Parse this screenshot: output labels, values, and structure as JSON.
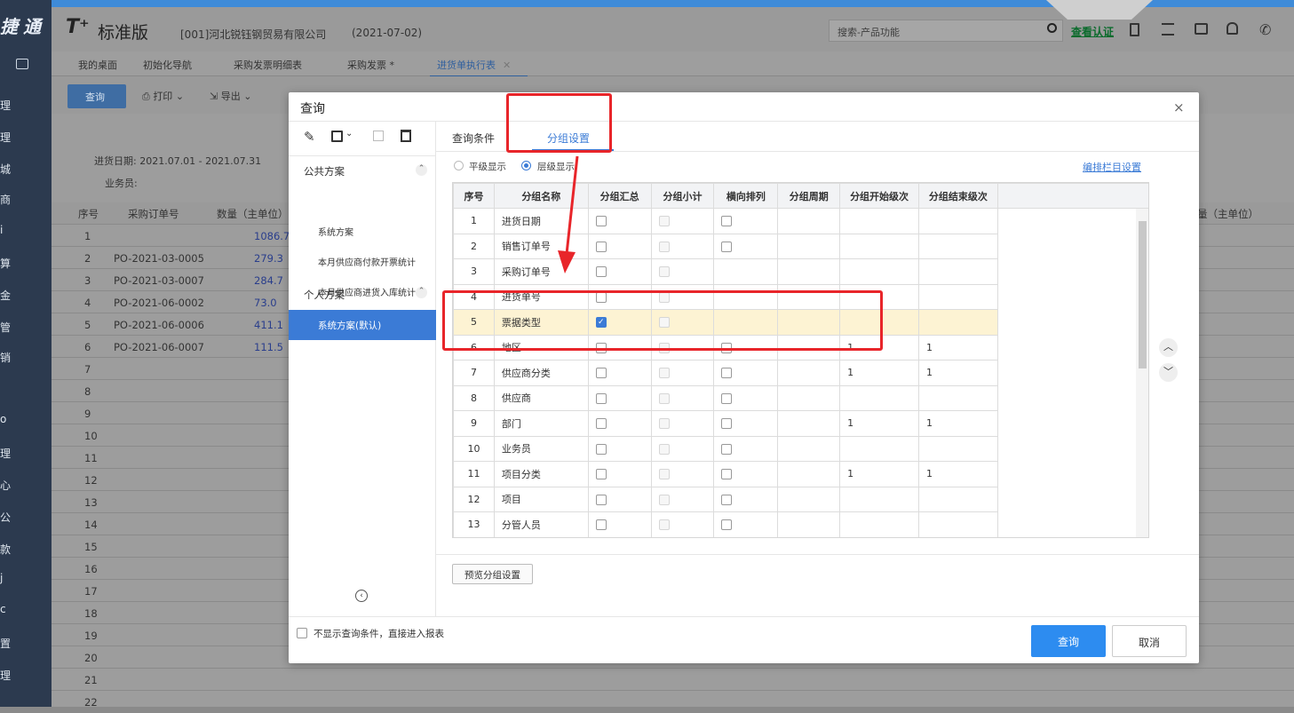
{
  "app": {
    "logo": "T⁺",
    "edition": "标准版",
    "company": "[001]河北锐钰钢贸易有限公司",
    "date": "(2021-07-02)",
    "search_placeholder": "搜索-产品功能",
    "verify_link": "查看认证",
    "sidebar_logo": "捷通",
    "sidebar_items": [
      "理",
      "理",
      "城",
      "商",
      "i",
      "算",
      "金",
      "管",
      "销",
      "o",
      "理",
      "心",
      "公",
      "款",
      "j",
      "c",
      "置",
      "理"
    ]
  },
  "tabs": [
    {
      "label": "我的桌面"
    },
    {
      "label": "初始化导航"
    },
    {
      "label": "采购发票明细表"
    },
    {
      "label": "采购发票 *"
    },
    {
      "label": "进货单执行表"
    }
  ],
  "toolbar": {
    "query": "查询",
    "print": "打印",
    "export": "导出"
  },
  "report": {
    "date_filter": "进货日期:  2021.07.01 - 2021.07.31",
    "staff_label": "业务员:",
    "col_no": "序号",
    "col_po": "采购订单号",
    "col_qty": "数量（主单位）",
    "col_right": "量（主单位）",
    "rows": [
      {
        "no": "1",
        "po": "",
        "qty": "1086.7"
      },
      {
        "no": "2",
        "po": "PO-2021-03-0005",
        "qty": "279.3"
      },
      {
        "no": "3",
        "po": "PO-2021-03-0007",
        "qty": "284.7"
      },
      {
        "no": "4",
        "po": "PO-2021-06-0002",
        "qty": "73.0"
      },
      {
        "no": "5",
        "po": "PO-2021-06-0006",
        "qty": "411.1"
      },
      {
        "no": "6",
        "po": "PO-2021-06-0007",
        "qty": "111.5"
      },
      {
        "no": "7",
        "po": "",
        "qty": ""
      },
      {
        "no": "8",
        "po": "",
        "qty": ""
      },
      {
        "no": "9",
        "po": "",
        "qty": ""
      },
      {
        "no": "10",
        "po": "",
        "qty": ""
      },
      {
        "no": "11",
        "po": "",
        "qty": ""
      },
      {
        "no": "12",
        "po": "",
        "qty": ""
      },
      {
        "no": "13",
        "po": "",
        "qty": ""
      },
      {
        "no": "14",
        "po": "",
        "qty": ""
      },
      {
        "no": "15",
        "po": "",
        "qty": ""
      },
      {
        "no": "16",
        "po": "",
        "qty": ""
      },
      {
        "no": "17",
        "po": "",
        "qty": ""
      },
      {
        "no": "18",
        "po": "",
        "qty": ""
      },
      {
        "no": "19",
        "po": "",
        "qty": ""
      },
      {
        "no": "20",
        "po": "",
        "qty": ""
      },
      {
        "no": "21",
        "po": "",
        "qty": ""
      },
      {
        "no": "22",
        "po": "",
        "qty": ""
      }
    ]
  },
  "dialog": {
    "title": "查询",
    "public_plans": "公共方案",
    "plans": [
      "系统方案",
      "本月供应商付款开票统计",
      "本月供应商进货入库统计"
    ],
    "personal_plans": "个人方案",
    "personal_default": "系统方案(默认)",
    "tab_conditions": "查询条件",
    "tab_grouping": "分组设置",
    "radio_flat": "平级显示",
    "radio_level": "层级显示",
    "column_settings": "编排栏目设置",
    "headers": [
      "序号",
      "分组名称",
      "分组汇总",
      "分组小计",
      "横向排列",
      "分组周期",
      "分组开始级次",
      "分组结束级次"
    ],
    "rows": [
      {
        "no": "1",
        "name": "进货日期",
        "sum": false,
        "sub": "dis",
        "horiz": true,
        "start": "",
        "end": ""
      },
      {
        "no": "2",
        "name": "销售订单号",
        "sum": false,
        "sub": "dis",
        "horiz": true,
        "start": "",
        "end": ""
      },
      {
        "no": "3",
        "name": "采购订单号",
        "sum": false,
        "sub": "dis",
        "horiz": false,
        "start": "",
        "end": ""
      },
      {
        "no": "4",
        "name": "进货单号",
        "sum": false,
        "sub": "dis",
        "horiz": false,
        "start": "",
        "end": ""
      },
      {
        "no": "5",
        "name": "票据类型",
        "sum": true,
        "sub": "dis",
        "horiz": false,
        "start": "",
        "end": ""
      },
      {
        "no": "6",
        "name": "地区",
        "sum": false,
        "sub": "dis",
        "horiz": true,
        "start": "1",
        "end": "1"
      },
      {
        "no": "7",
        "name": "供应商分类",
        "sum": false,
        "sub": "dis",
        "horiz": true,
        "start": "1",
        "end": "1"
      },
      {
        "no": "8",
        "name": "供应商",
        "sum": false,
        "sub": "dis",
        "horiz": true,
        "start": "",
        "end": ""
      },
      {
        "no": "9",
        "name": "部门",
        "sum": false,
        "sub": "dis",
        "horiz": true,
        "start": "1",
        "end": "1"
      },
      {
        "no": "10",
        "name": "业务员",
        "sum": false,
        "sub": "dis",
        "horiz": true,
        "start": "",
        "end": ""
      },
      {
        "no": "11",
        "name": "项目分类",
        "sum": false,
        "sub": "dis",
        "horiz": true,
        "start": "1",
        "end": "1"
      },
      {
        "no": "12",
        "name": "项目",
        "sum": false,
        "sub": "dis",
        "horiz": true,
        "start": "",
        "end": ""
      },
      {
        "no": "13",
        "name": "分管人员",
        "sum": false,
        "sub": "dis",
        "horiz": true,
        "start": "",
        "end": ""
      }
    ],
    "preview_button": "预览分组设置",
    "skip_checkbox": "不显示查询条件，直接进入报表",
    "ok_button": "查询",
    "cancel_button": "取消"
  },
  "colors": {
    "accent": "#3b7bd6",
    "highlight": "#fdf3d3",
    "annotation": "#e8252a"
  }
}
